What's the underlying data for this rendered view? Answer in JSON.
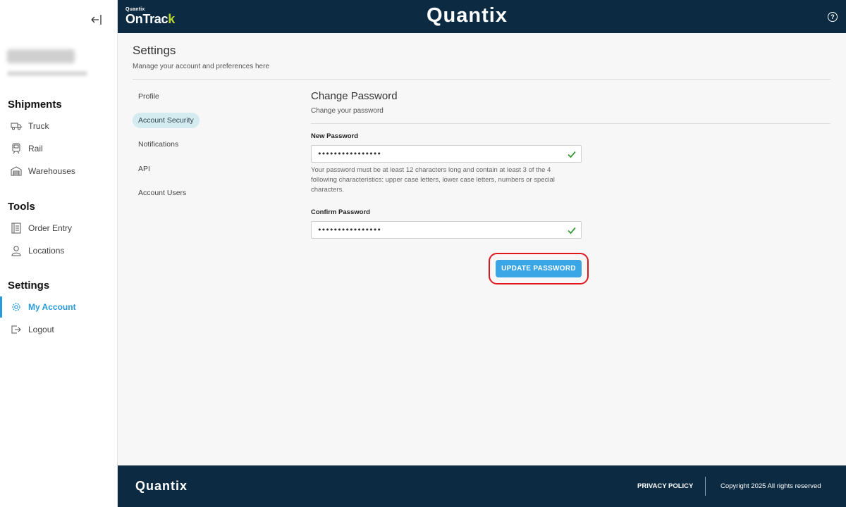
{
  "header": {
    "brand_small_top": "Quantix",
    "brand_small_main": "OnTrac",
    "brand_small_accent": "k",
    "brand_center": "Quantix",
    "help_label": "?"
  },
  "sidebar": {
    "sections": [
      {
        "title": "Shipments",
        "items": [
          {
            "label": "Truck",
            "icon": "truck-icon"
          },
          {
            "label": "Rail",
            "icon": "train-icon"
          },
          {
            "label": "Warehouses",
            "icon": "warehouse-icon"
          }
        ]
      },
      {
        "title": "Tools",
        "items": [
          {
            "label": "Order Entry",
            "icon": "order-icon"
          },
          {
            "label": "Locations",
            "icon": "person-icon"
          }
        ]
      },
      {
        "title": "Settings",
        "items": [
          {
            "label": "My Account",
            "icon": "gear-icon",
            "active": true
          },
          {
            "label": "Logout",
            "icon": "logout-icon"
          }
        ]
      }
    ]
  },
  "settings": {
    "title": "Settings",
    "subtitle": "Manage your account and preferences here",
    "tabs": [
      {
        "label": "Profile"
      },
      {
        "label": "Account Security",
        "active": true
      },
      {
        "label": "Notifications"
      },
      {
        "label": "API"
      },
      {
        "label": "Account Users"
      }
    ]
  },
  "change_password": {
    "title": "Change Password",
    "subtitle": "Change your password",
    "new_password_label": "New Password",
    "new_password_value": "••••••••••••••••",
    "hint": "Your password must be at least 12 characters long and contain at least 3 of the 4 following characteristics: upper case letters, lower case letters, numbers or special characters.",
    "confirm_password_label": "Confirm Password",
    "confirm_password_value": "••••••••••••••••",
    "submit_label": "UPDATE PASSWORD"
  },
  "footer": {
    "brand": "Quantix",
    "privacy": "PRIVACY POLICY",
    "copyright": "Copyright 2025 All rights reserved"
  },
  "colors": {
    "navy": "#0c2b43",
    "accent": "#2a9ad6",
    "button": "#3aa6e6",
    "highlight": "#e0161d",
    "check": "#3a9a3a"
  }
}
